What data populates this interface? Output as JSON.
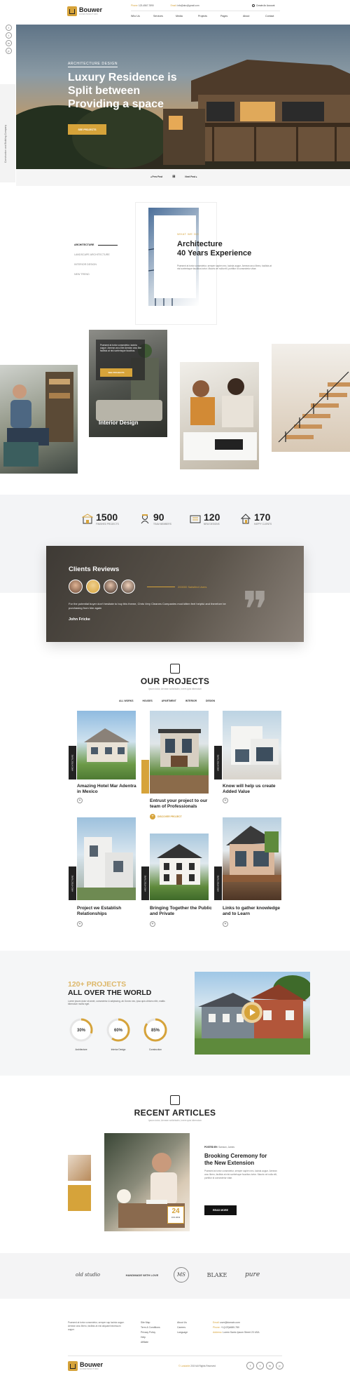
{
  "header": {
    "logo_name": "Bouwer",
    "logo_tagline": "CONSTRUCTION",
    "phone_label": "Phone",
    "phone": "123-4567-7890",
    "email_label": "Email",
    "email": "info@abc@gmail.com",
    "account_label": "Create An Account",
    "nav": [
      "Who Us",
      "Services",
      "Media",
      "Projects",
      "Pages",
      "About",
      "Contact"
    ]
  },
  "social": [
    "f",
    "t",
    "in",
    "p"
  ],
  "hero": {
    "eyebrow": "ARCHITECTURE DESIGN",
    "title_line1": "Luxury Residence is",
    "title_line2": "Split between",
    "title_line3": "Providing a space",
    "button": "SEE PROJECTS",
    "side_text": "Construction and Building Company",
    "prev": "Prev Post",
    "next": "Next Post"
  },
  "about": {
    "menu": [
      "ARCHITECTURE",
      "LANDSCAPE ARCHITECTURE",
      "INTERIOR DESIGN",
      "NEW TREND"
    ],
    "eyebrow": "WHAT WE DO",
    "title_line1": "Architecture",
    "title_line2": "40 Years Experience",
    "text": "Praesent at tortor consectetur, semper sapien nec, lacinia augue. Aenean arcu libero, facilisis at nisi scelerisque faucibus tortor. Mauris vel nulla elit, porttitor id consectetur vitae."
  },
  "gallery": {
    "card_text": "Praesent at tortor consectetur, lacinia augue. Aenean arcu libe Aenean arcu libe facilisis at nisi scelerisque faucibus.",
    "card_button": "SEE PROJECTS",
    "card_title": "Interior Design"
  },
  "stats": [
    {
      "icon": "building-icon",
      "value": "1500",
      "label": "FINISHED PROJECTS"
    },
    {
      "icon": "worker-icon",
      "value": "90",
      "label": "TEAM MEMBERS"
    },
    {
      "icon": "blueprint-icon",
      "value": "120",
      "label": "NEW DESIGNS"
    },
    {
      "icon": "house-icon",
      "value": "170",
      "label": "HAPPY CLIENTS"
    }
  ],
  "reviews": {
    "title": "Clients Reviews",
    "satisfied": "200000 Satisfied Users",
    "quote": "For the potential buyer don't hesitate to buy this theme, Chris Very Cleanes Companies mod kitten feel  helpful and therefore be purchasing from him again",
    "author": "John Fricke"
  },
  "projects": {
    "title": "OUR PROJECTS",
    "subtitle": "Ipsum dolor, Aenean sollicitudin, lorem quis bibendum",
    "filters": [
      "ALL WORKS",
      "HOUSES",
      "APARTMENT",
      "INTERIOR",
      "DESIGN"
    ],
    "tab": "ARCHITECTURE",
    "discover": "DISCOVER PROJECT",
    "items": [
      "Amazing Hotel Mar Adentra in Mexico",
      "Entrust your project to our team of Professionals",
      "Know will help us create Added Value",
      "Project we Establish Relationships",
      "Bringing Together the Public and Private",
      "Links to gather knowledge and to Learn"
    ]
  },
  "world": {
    "title_line1": "120+ PROJECTS",
    "title_line2": "ALL OVER THE WORLD",
    "text": "Lorem ipsum dolor sit amet, consectetur & adipiscing, ab Donec nec, ipsa quis ultrices nibh, mattis bibendum mollis eget.",
    "progress": [
      {
        "value": 30,
        "text": "30%",
        "label": "Architecture"
      },
      {
        "value": 60,
        "text": "60%",
        "label": "Interior Design"
      },
      {
        "value": 85,
        "text": "85%",
        "label": "Construction"
      }
    ]
  },
  "articles": {
    "title": "RECENT ARTICLES",
    "subtitle": "Ipsum dolor, Aenean sollicitudin, lorem quis bibendum",
    "posted_by_label": "POSTED BY:",
    "posted_by": "Samson, James",
    "title_line1": "Brooking Ceremony for",
    "title_line2": "the New Extension",
    "text": "Praesent at tortor consectetur, semper sapien nec, lacinia augue. Aenean arcu libero, facilisis at nisi scelerisque faucibus tortor. Mauris vel nulla elit, porttitor id consectetur vitae.",
    "button": "READ MORE",
    "date_day": "24",
    "date_month": "JUN 2019"
  },
  "brands": [
    "old studio",
    "HANDMADE WITH LOVE",
    "MS",
    "BLAKE",
    "pure"
  ],
  "footer": {
    "text": "Praesent at tortor consectetur, semper sap lacinia augue. Aenean arcu libero, facilisis at nisi aliquam/necessum augue.",
    "col1": [
      "Site Map",
      "Term & Conditions",
      "Privacy Policy",
      "Help",
      "Affiliate"
    ],
    "col2": [
      "About Us",
      "Careers",
      "Language"
    ],
    "email_label": "Email:",
    "email": "user@domain.com",
    "phone_label": "Phone:",
    "phone": "+1(123)4680-780",
    "address_label": "Address:",
    "address": "Lorem Santo Ipsum Street 23 USA",
    "copyright_brand": "© Landable",
    "copyright": "2019 All Rights Reserved",
    "social": [
      "f",
      "t",
      "in",
      "p"
    ]
  },
  "colors": {
    "accent": "#d6a33a",
    "dark": "#222222"
  }
}
